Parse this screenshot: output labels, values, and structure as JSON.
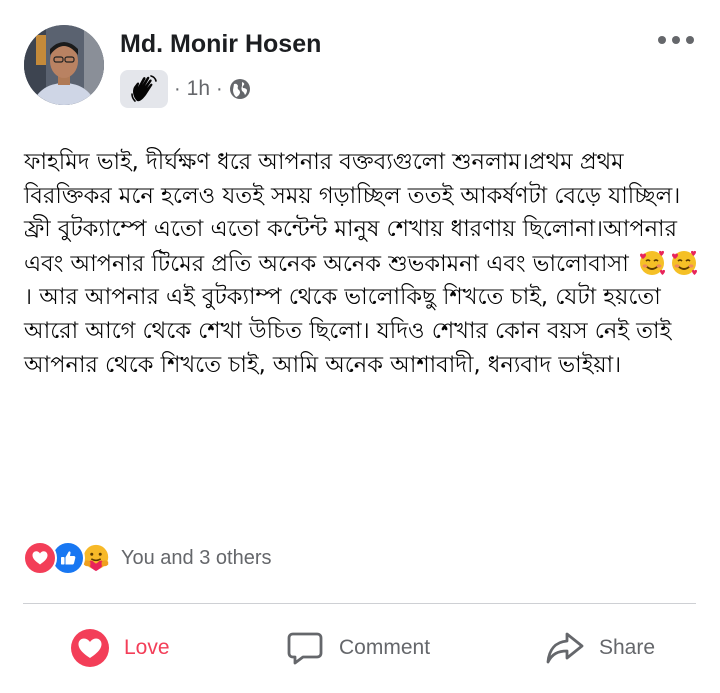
{
  "post": {
    "author": "Md. Monir Hosen",
    "time": "1h",
    "separator": "·",
    "text_part1": "ফাহমিদ ভাই, দীর্ঘক্ষণ ধরে আপনার বক্তব্যগুলো শুনলাম।প্রথম প্রথম বিরক্তিকর মনে হলেও যতই সময় গড়াচ্ছিল ততই আকর্ষণটা বেড়ে যাচ্ছিল। ফ্রী বুটক্যাম্পে এতো এতো কন্টেন্ট মানুষ শেখায় ধারণায় ছিলোনা।আপনার এবং আপনার টিমের প্রতি অনেক অনেক শুভকামনা এবং ভালোবাসা",
    "text_part2": "। আর আপনার এই বুটক্যাম্প থেকে ভালোকিছু শিখতে চাই, যেটা হয়তো আরো আগে থেকে শেখা উচিত ছিলো। যদিও শেখার কোন বয়স নেই তাই আপনার থেকে শিখতে চাই, আমি অনেক আশাবাদী, ধন্যবাদ ভাইয়া।",
    "inline_emoji": "smiling-face-with-hearts"
  },
  "reactions": {
    "summary": "You and 3 others",
    "icons": [
      "love",
      "like",
      "care"
    ]
  },
  "actions": {
    "love_label": "Love",
    "comment_label": "Comment",
    "share_label": "Share"
  },
  "colors": {
    "love": "#f33e58",
    "like": "#1877f2",
    "muted": "#65676b",
    "text": "#050505"
  },
  "icons": {
    "badge": "waving-hand-icon",
    "audience": "globe-icon",
    "more": "more-options-icon"
  }
}
